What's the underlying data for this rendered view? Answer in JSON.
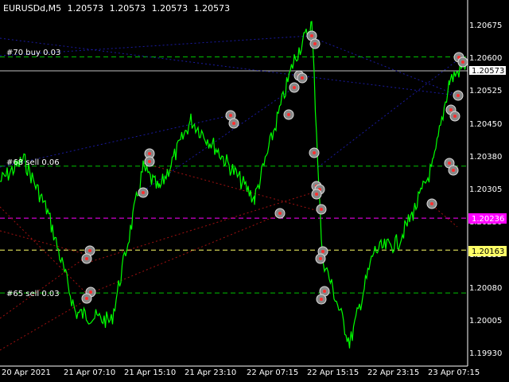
{
  "header": {
    "symbol_tf": "EURUSDd,M5",
    "ohlc": [
      "1.20573",
      "1.20573",
      "1.20573",
      "1.20573"
    ]
  },
  "y_labels": [
    "1.20675",
    "1.20600",
    "1.20525",
    "1.20450",
    "1.20380",
    "1.20305",
    "1.20230",
    "1.20155",
    "1.20080",
    "1.20005",
    "1.19930"
  ],
  "x_labels": [
    "20 Apr 2021",
    "21 Apr 07:10",
    "21 Apr 15:10",
    "21 Apr 23:10",
    "22 Apr 07:15",
    "22 Apr 15:15",
    "22 Apr 23:15",
    "23 Apr 07:15"
  ],
  "price_boxes": {
    "current": {
      "value": "1.20573",
      "bg": "#ffffff",
      "fg": "#000000"
    },
    "magenta": {
      "value": "1.20236",
      "bg": "#ff00ff",
      "fg": "#ffffff"
    },
    "yellow": {
      "value": "1.20163",
      "bg": "#ffff66",
      "fg": "#000000"
    }
  },
  "order_labels": [
    {
      "text": "#70 buy 0.03",
      "price": 1.20605
    },
    {
      "text": "#68 sell 0.06",
      "price": 1.20355
    },
    {
      "text": "#65 sell 0.03",
      "price": 1.20065
    }
  ],
  "colors": {
    "price_line": "#00ff00",
    "background": "#000000",
    "grid": "#ffffff",
    "buy": "#1010a0",
    "sell": "#a01010",
    "order_level": "#00c000"
  },
  "chart_data": {
    "type": "line",
    "title": "EURUSDd,M5",
    "x": [
      "20 Apr 2021",
      "21 Apr 07:10",
      "21 Apr 15:10",
      "21 Apr 23:10",
      "22 Apr 07:15",
      "22 Apr 15:15",
      "22 Apr 23:15",
      "23 Apr 07:15"
    ],
    "ylim": [
      1.199,
      1.2072
    ],
    "series": [
      {
        "values": [
          1.2032,
          1.2037,
          1.2025,
          1.2002,
          1.2,
          1.2035,
          1.203,
          1.2046,
          1.204,
          1.2028,
          1.206,
          1.2068,
          1.2015,
          1.1995,
          1.2016,
          1.2018,
          1.2025,
          1.2036,
          1.2055,
          1.2059
        ]
      }
    ],
    "levels": [
      {
        "value": 1.20605,
        "color": "#00c000",
        "style": "dash"
      },
      {
        "value": 1.20573,
        "color": "#c0c0c0",
        "style": "solid"
      },
      {
        "value": 1.20355,
        "color": "#00c000",
        "style": "dash"
      },
      {
        "value": 1.20236,
        "color": "#ff00ff",
        "style": "dash"
      },
      {
        "value": 1.20163,
        "color": "#ffff66",
        "style": "dash"
      },
      {
        "value": 1.20065,
        "color": "#00c000",
        "style": "dash"
      }
    ],
    "grid": false
  }
}
